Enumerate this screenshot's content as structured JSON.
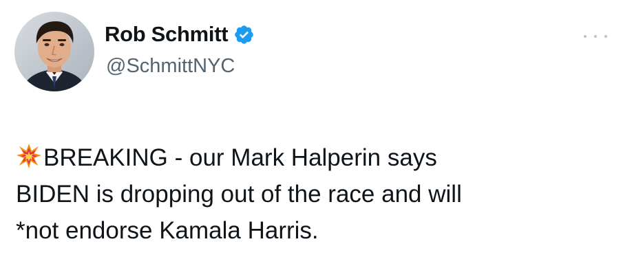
{
  "tweet": {
    "author": {
      "display_name": "Rob Schmitt",
      "handle": "@SchmittNYC",
      "avatar_icon": "profile-photo",
      "verified_icon": "verified-checkmark-icon",
      "verified_color": "#1d9bf0"
    },
    "more_icon": "more-horizontal-icon",
    "text": {
      "emoji_icon": "collision-emoji-icon",
      "line1": "BREAKING - our Mark Halperin says",
      "line2": "BIDEN is dropping out of the race and will",
      "line3": "*not endorse Kamala Harris."
    }
  }
}
